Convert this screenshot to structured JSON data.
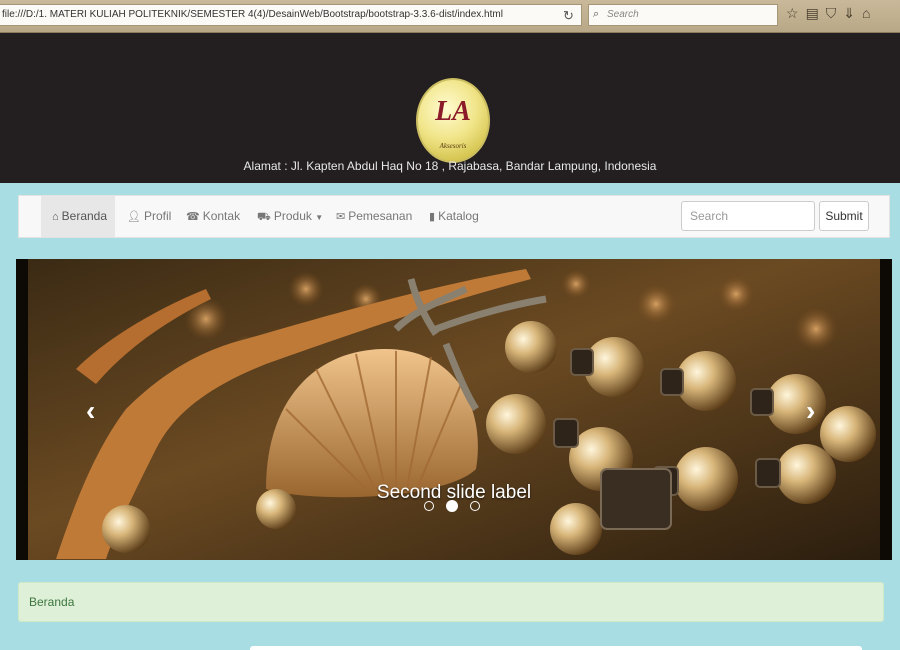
{
  "browser": {
    "url": "file:///D:/1. MATERI KULIAH POLITEKNIK/SEMESTER 4(4)/DesainWeb/Bootstrap/bootstrap-3.3.6-dist/index.html",
    "search_placeholder": "Search",
    "icons": [
      "reload-icon",
      "star-icon",
      "bookmarks-icon",
      "shield-icon",
      "download-icon",
      "home-icon"
    ]
  },
  "header": {
    "logo_text": "LA",
    "logo_subtext": "Aksesoris",
    "address": "Alamat : Jl. Kapten Abdul Haq No 18 , Rajabasa, Bandar Lampung, Indonesia"
  },
  "navbar": {
    "items": [
      {
        "label": "Beranda",
        "icon": "home-icon",
        "active": true
      },
      {
        "label": "Profil",
        "icon": "user-icon"
      },
      {
        "label": "Kontak",
        "icon": "phone-icon"
      },
      {
        "label": "Produk",
        "icon": "cart-icon",
        "dropdown": true
      },
      {
        "label": "Pemesanan",
        "icon": "envelope-icon"
      },
      {
        "label": "Katalog",
        "icon": "book-icon"
      }
    ],
    "search_placeholder": "Search",
    "submit_label": "Submit"
  },
  "carousel": {
    "caption": "Second slide label",
    "slide_count": 3,
    "active_index": 1
  },
  "breadcrumb": {
    "text": "Beranda"
  }
}
